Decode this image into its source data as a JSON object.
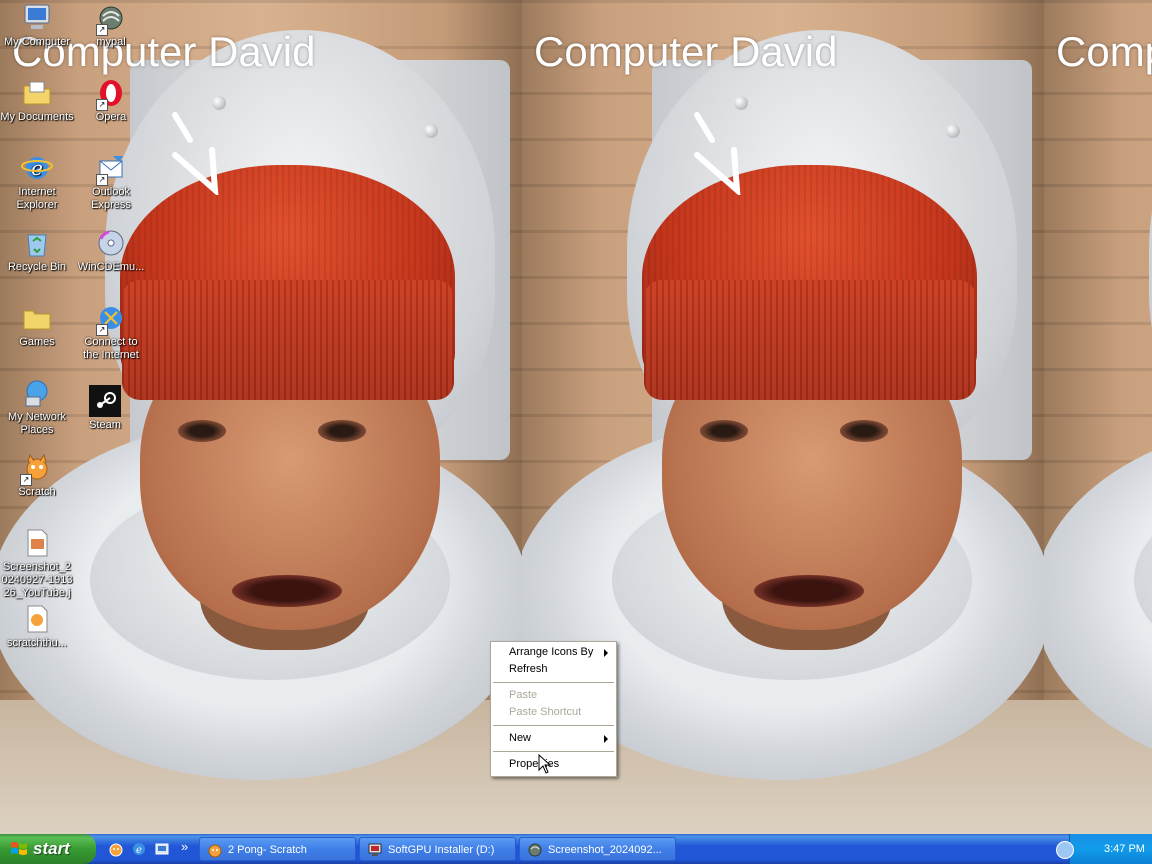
{
  "overlay_text": "Computer David",
  "overlay_text_partial": "Comp",
  "desktop_icons": [
    {
      "id": "my-computer",
      "label": "My Computer",
      "icon": "computer-icon"
    },
    {
      "id": "mypal",
      "label": "mypal",
      "icon": "mypal-icon"
    },
    {
      "id": "my-documents",
      "label": "My Documents",
      "icon": "folder-documents-icon"
    },
    {
      "id": "opera",
      "label": "Opera",
      "icon": "opera-icon"
    },
    {
      "id": "internet-explorer",
      "label1": "Internet",
      "label2": "Explorer",
      "icon": "internet-explorer-icon"
    },
    {
      "id": "outlook-express",
      "label1": "Outlook",
      "label2": "Express",
      "icon": "outlook-express-icon"
    },
    {
      "id": "recycle-bin",
      "label": "Recycle Bin",
      "icon": "recycle-bin-icon"
    },
    {
      "id": "wincdemu",
      "label": "WinCDEmu...",
      "icon": "cd-icon"
    },
    {
      "id": "games",
      "label": "Games",
      "icon": "folder-icon"
    },
    {
      "id": "connect-internet",
      "label1": "Connect to",
      "label2": "the Internet",
      "icon": "connect-icon"
    },
    {
      "id": "my-network-places",
      "label1": "My Network",
      "label2": "Places",
      "icon": "network-icon"
    },
    {
      "id": "steam",
      "label": "Steam",
      "icon": "steam-icon"
    },
    {
      "id": "scratch",
      "label": "Scratch",
      "icon": "scratch-cat-icon"
    },
    {
      "id": "screenshot-file",
      "label1": "Screenshot_2",
      "label2": "0240927-1913",
      "label3": "26_YouTube.j",
      "icon": "image-file-icon"
    },
    {
      "id": "scratchthu",
      "label": "scratchthu...",
      "icon": "image-file-icon"
    }
  ],
  "context_menu": {
    "arrange": "Arrange Icons By",
    "refresh": "Refresh",
    "paste": "Paste",
    "paste_shortcut": "Paste Shortcut",
    "new": "New",
    "properties": "Properties"
  },
  "taskbar": {
    "start_label": "start",
    "buttons": [
      {
        "label": "2 Pong- Scratch",
        "icon": "scratch-cat-icon"
      },
      {
        "label": "SoftGPU Installer (D:)",
        "icon": "installer-icon"
      },
      {
        "label": "Screenshot_2024092...",
        "icon": "mypal-icon"
      }
    ],
    "clock": "3:47 PM",
    "more_chevron": "»"
  },
  "colors": {
    "taskbar_blue": "#2157d7",
    "start_green": "#379c32",
    "tray_blue": "#109ce9",
    "beanie_red": "#c4361c"
  }
}
